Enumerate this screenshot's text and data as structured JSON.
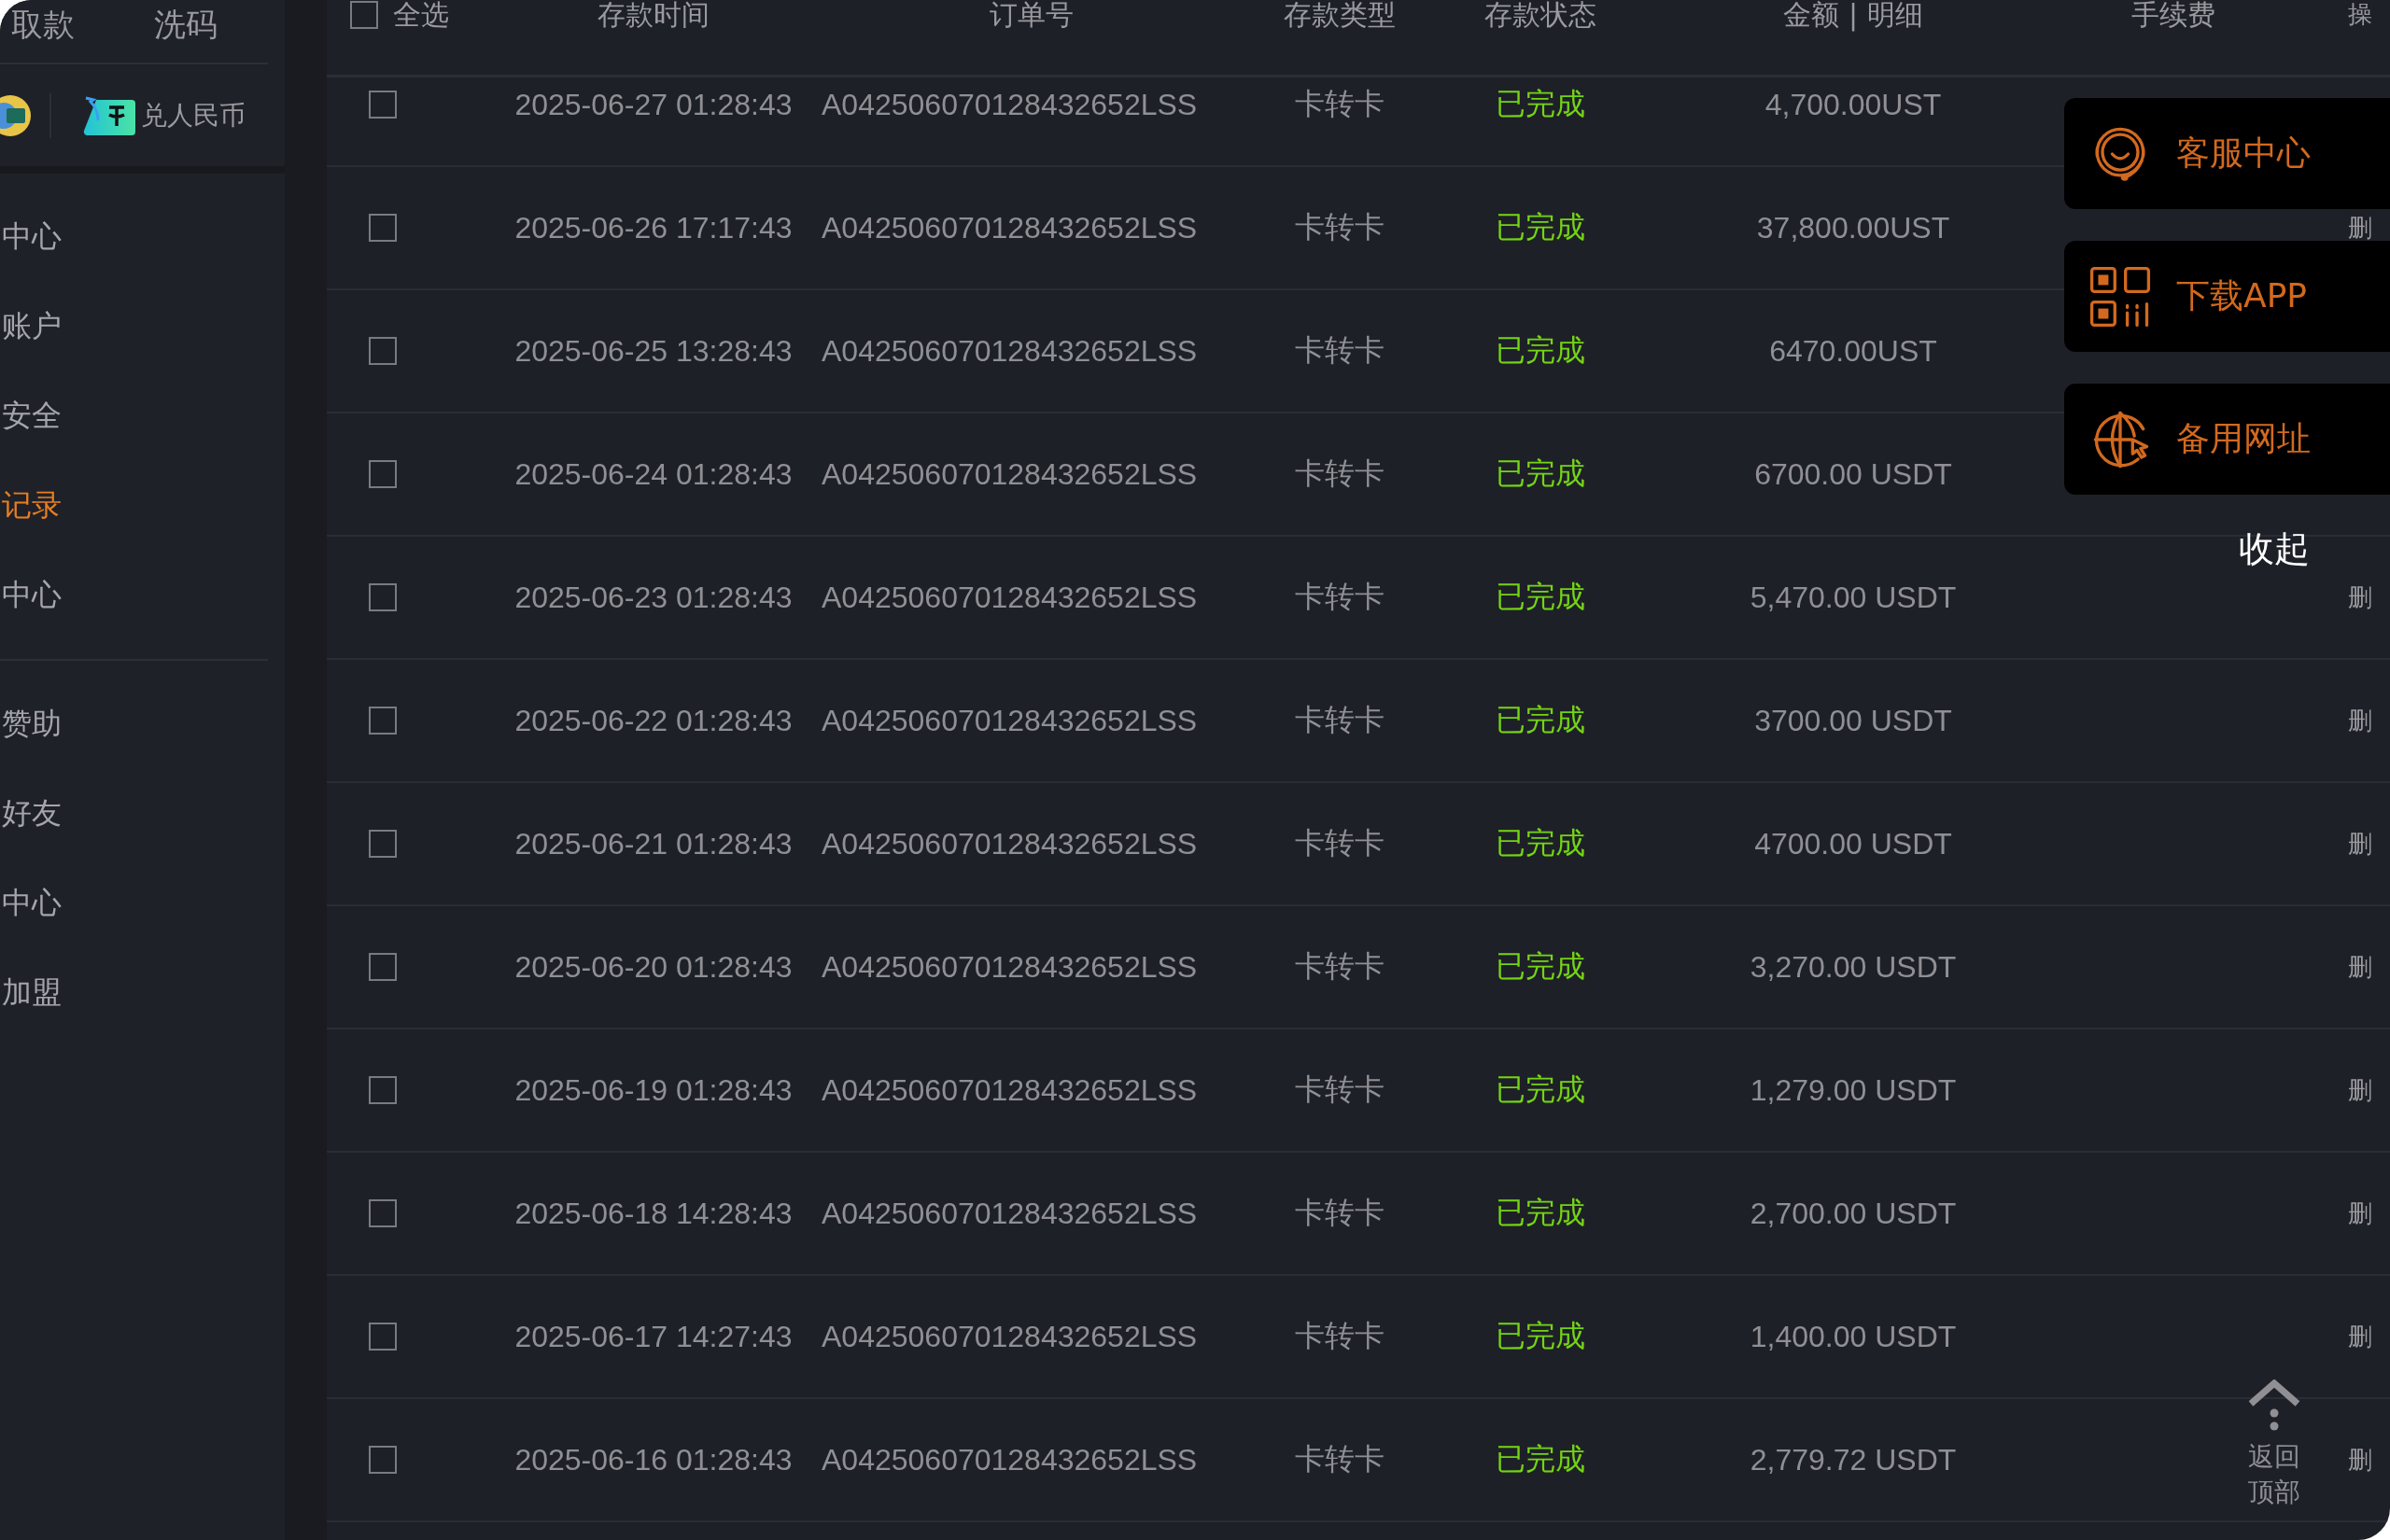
{
  "sidebar": {
    "tabs": [
      {
        "label": "取款"
      },
      {
        "label": "洗码"
      }
    ],
    "exchange_label": "兑人民币",
    "groups": [
      [
        {
          "label": "中心",
          "selected": false
        },
        {
          "label": "账户",
          "selected": false
        },
        {
          "label": "安全",
          "selected": false
        },
        {
          "label": "记录",
          "selected": true
        },
        {
          "label": "中心",
          "selected": false
        }
      ],
      [
        {
          "label": "赞助",
          "selected": false
        },
        {
          "label": "好友",
          "selected": false
        },
        {
          "label": "中心",
          "selected": false
        },
        {
          "label": "加盟",
          "selected": false
        }
      ]
    ]
  },
  "table": {
    "select_all_checked": false,
    "columns": [
      "全选",
      "存款时间",
      "订单号",
      "存款类型",
      "存款状态",
      "金额 | 明细",
      "手续费",
      "操"
    ],
    "rows": [
      {
        "checked": false,
        "time": "2025-06-27 01:28:43",
        "order": "A042506070128432652LSS",
        "type": "卡转卡",
        "status": "已完成",
        "amount": "4,700.00UST"
      },
      {
        "checked": false,
        "time": "2025-06-26 17:17:43",
        "order": "A042506070128432652LSS",
        "type": "卡转卡",
        "status": "已完成",
        "amount": "37,800.00UST",
        "action": "删"
      },
      {
        "checked": false,
        "time": "2025-06-25 13:28:43",
        "order": "A042506070128432652LSS",
        "type": "卡转卡",
        "status": "已完成",
        "amount": "6470.00UST"
      },
      {
        "checked": false,
        "time": "2025-06-24 01:28:43",
        "order": "A042506070128432652LSS",
        "type": "卡转卡",
        "status": "已完成",
        "amount": "6700.00 USDT"
      },
      {
        "checked": false,
        "time": "2025-06-23 01:28:43",
        "order": "A042506070128432652LSS",
        "type": "卡转卡",
        "status": "已完成",
        "amount": "5,470.00 USDT",
        "action": "删"
      },
      {
        "checked": false,
        "time": "2025-06-22 01:28:43",
        "order": "A042506070128432652LSS",
        "type": "卡转卡",
        "status": "已完成",
        "amount": "3700.00 USDT",
        "action": "删"
      },
      {
        "checked": false,
        "time": "2025-06-21 01:28:43",
        "order": "A042506070128432652LSS",
        "type": "卡转卡",
        "status": "已完成",
        "amount": "4700.00 USDT",
        "action": "删"
      },
      {
        "checked": false,
        "time": "2025-06-20 01:28:43",
        "order": "A042506070128432652LSS",
        "type": "卡转卡",
        "status": "已完成",
        "amount": "3,270.00 USDT",
        "action": "删"
      },
      {
        "checked": false,
        "time": "2025-06-19 01:28:43",
        "order": "A042506070128432652LSS",
        "type": "卡转卡",
        "status": "已完成",
        "amount": "1,279.00 USDT",
        "action": "删"
      },
      {
        "checked": false,
        "time": "2025-06-18 14:28:43",
        "order": "A042506070128432652LSS",
        "type": "卡转卡",
        "status": "已完成",
        "amount": "2,700.00 USDT",
        "action": "删"
      },
      {
        "checked": false,
        "time": "2025-06-17 14:27:43",
        "order": "A042506070128432652LSS",
        "type": "卡转卡",
        "status": "已完成",
        "amount": "1,400.00 USDT",
        "action": "删"
      },
      {
        "checked": false,
        "time": "2025-06-16 01:28:43",
        "order": "A042506070128432652LSS",
        "type": "卡转卡",
        "status": "已完成",
        "amount": "2,779.72 USDT",
        "action": "删"
      }
    ]
  },
  "float_menu": [
    {
      "kind": "support",
      "label": "客服中心"
    },
    {
      "kind": "qr",
      "label": "下载APP"
    },
    {
      "kind": "globe",
      "label": "备用网址"
    }
  ],
  "collapse_label": "收起",
  "back_to_top": "返回顶部"
}
